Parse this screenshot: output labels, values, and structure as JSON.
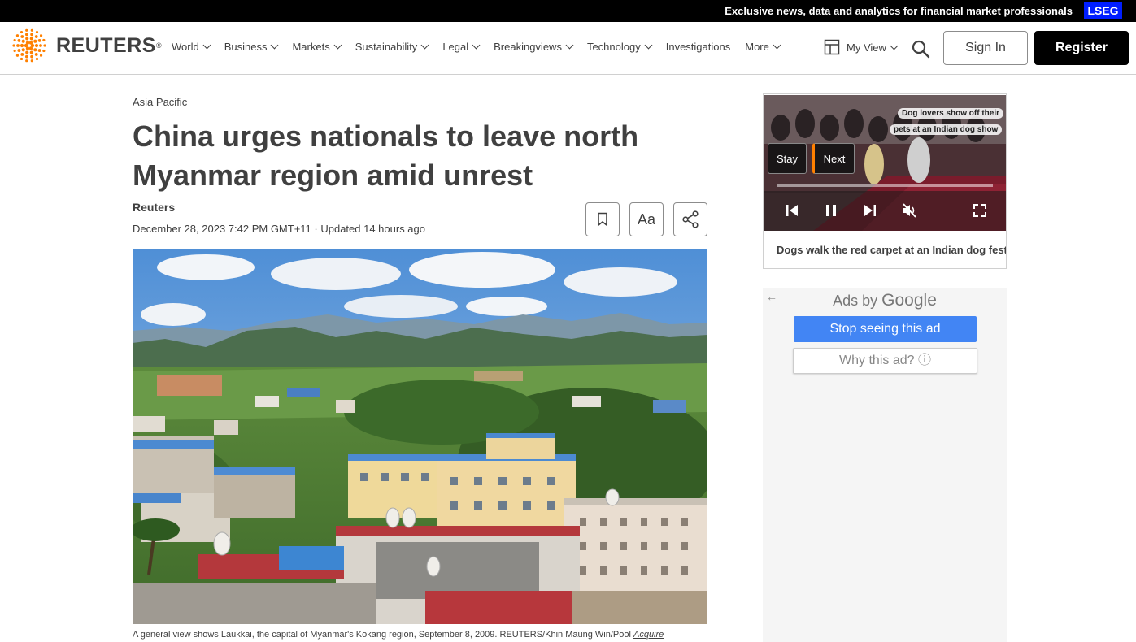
{
  "promo": {
    "text": "Exclusive news, data and analytics for financial market professionals",
    "badge": "LSEG"
  },
  "header": {
    "logo_text": "REUTERS",
    "logo_mark": "®",
    "nav": [
      {
        "label": "World",
        "has_dropdown": true
      },
      {
        "label": "Business",
        "has_dropdown": true
      },
      {
        "label": "Markets",
        "has_dropdown": true
      },
      {
        "label": "Sustainability",
        "has_dropdown": true
      },
      {
        "label": "Legal",
        "has_dropdown": true
      },
      {
        "label": "Breakingviews",
        "has_dropdown": true
      },
      {
        "label": "Technology",
        "has_dropdown": true
      },
      {
        "label": "Investigations",
        "has_dropdown": false
      },
      {
        "label": "More",
        "has_dropdown": true
      }
    ],
    "my_view": "My View",
    "sign_in": "Sign In",
    "register": "Register",
    "brand_color": "#ff8000"
  },
  "article": {
    "section": "Asia Pacific",
    "headline": "China urges nationals to leave north Myanmar region amid unrest",
    "byline": "Reuters",
    "dateline": "December 28, 2023 7:42 PM GMT+11 · Updated 14 hours ago",
    "tools": {
      "font_size_label": "Aa"
    },
    "caption": "A general view shows Laukkai, the capital of Myanmar's Kokang region, September 8, 2009. REUTERS/Khin Maung Win/Pool ",
    "caption_link": "Acquire"
  },
  "video": {
    "overlay_tag_1": "Dog lovers show off their",
    "overlay_tag_2": "pets at an Indian dog show",
    "stay_label": "Stay",
    "next_label": "Next",
    "title": "Dogs walk the red carpet at an Indian dog festival"
  },
  "ad": {
    "back_arrow": "←",
    "ads_by": "Ads by",
    "google": "Google",
    "stop_label": "Stop seeing this ad",
    "why_label": "Why this ad? ⓘ"
  }
}
